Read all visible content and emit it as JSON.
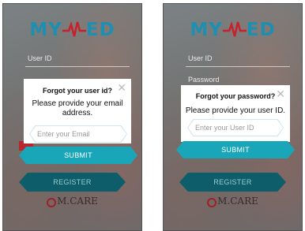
{
  "app": {
    "logo_left": "MY",
    "logo_right": "ED",
    "brand": "M.CARE",
    "register_label": "REGISTER"
  },
  "left_screen": {
    "user_id_placeholder": "User ID",
    "dialog": {
      "title": "Forgot your user id?",
      "message": "Please provide your email address.",
      "input_placeholder": "Enter your Email",
      "submit_label": "SUBMIT"
    }
  },
  "right_screen": {
    "user_id_placeholder": "User ID",
    "password_placeholder": "Password",
    "dialog": {
      "title": "Forgot your password?",
      "message": "Please provide your user ID.",
      "input_placeholder": "Enter your User ID",
      "submit_label": "SUBMIT"
    }
  },
  "colors": {
    "brand_blue": "#1e8fb0",
    "heartbeat_red": "#c8202c",
    "submit_teal": "#1aa6b9",
    "register_dark": "#0d5e6a"
  }
}
